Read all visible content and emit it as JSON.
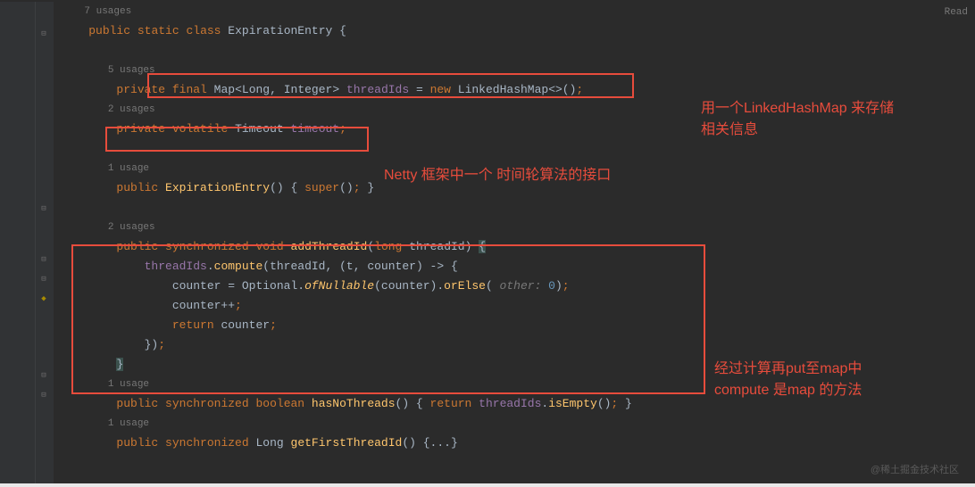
{
  "topRight": "Read",
  "watermark": "@稀土掘金技术社区",
  "usages": {
    "u7": "7 usages",
    "u5": "5 usages",
    "u2a": "2 usages",
    "u1a": "1 usage",
    "u2b": "2 usages",
    "u1b": "1 usage",
    "u1c": "1 usage"
  },
  "tokens": {
    "public": "public",
    "static": "static",
    "class": "class",
    "private": "private",
    "final": "final",
    "volatile": "volatile",
    "synchronized": "synchronized",
    "void": "void",
    "boolean": "boolean",
    "long": "long",
    "new": "new",
    "return": "return",
    "super": "super",
    "ExpirationEntry": "ExpirationEntry",
    "Map": "Map",
    "Long": "Long",
    "Integer": "Integer",
    "threadIds": "threadIds",
    "LinkedHashMap": "LinkedHashMap",
    "Timeout": "Timeout",
    "timeout": "timeout",
    "addThreadId": "addThreadId",
    "threadId": "threadId",
    "compute": "compute",
    "t": "t",
    "counter": "counter",
    "Optional": "Optional",
    "ofNullable": "ofNullable",
    "orElse": "orElse",
    "otherHint": " other: ",
    "zero": "0",
    "counterPlus": "counter++",
    "hasNoThreads": "hasNoThreads",
    "isEmpty": "isEmpty",
    "getFirstThreadId": "getFirstThreadId",
    "ellipsis": "{...}"
  },
  "annotations": {
    "a1_line1": "用一个LinkedHashMap 来存储",
    "a1_line2": "相关信息",
    "a2": "Netty 框架中一个 时间轮算法的接口",
    "a3_line1": "经过计算再put至map中",
    "a3_line2": "compute 是map 的方法"
  }
}
